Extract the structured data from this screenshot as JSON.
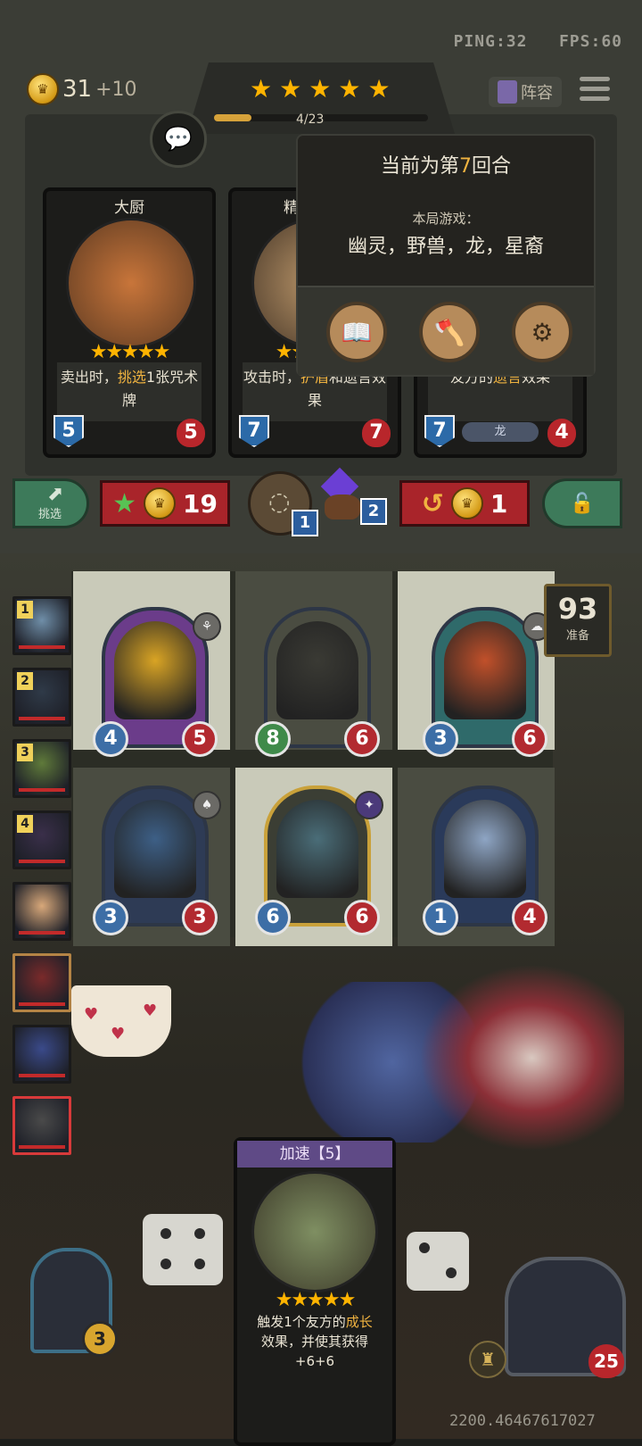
{
  "status": {
    "ping_label": "PING:32",
    "fps_label": "FPS:60"
  },
  "gold": {
    "amount": "31",
    "income": "+10"
  },
  "tavern": {
    "stars": 5,
    "xp_text": "4/23",
    "xp_fraction": 0.174
  },
  "lineup_label": "阵容",
  "shop_cards": [
    {
      "name": "大厨",
      "stars": 5,
      "desc_pre": "卖出时，",
      "desc_hl": "挑选",
      "desc_post": "1张咒术牌",
      "attack": "5",
      "health": "5"
    },
    {
      "name": "精",
      "stars": 5,
      "desc_pre": "攻击时，",
      "desc_hl": "护盾",
      "desc_post": "和遗言效果",
      "attack": "7",
      "health": "7"
    },
    {
      "name": "",
      "stars": 5,
      "desc_pre": "友方的",
      "desc_hl": "遗言",
      "desc_post": "效果",
      "attack": "7",
      "health": "4",
      "tribe": "龙"
    }
  ],
  "popover": {
    "round_pre": "当前为第",
    "round_num": "7",
    "round_post": "回合",
    "game_label": "本局游戏：",
    "tribes": "幽灵，野兽，龙，星裔",
    "buttons": [
      "book-icon",
      "axe-icon",
      "gear-icon"
    ]
  },
  "actions": {
    "pick_label": "挑选",
    "upgrade_cost": "19",
    "refresh_cost": "1",
    "item1_count": "1",
    "item2_count": "2"
  },
  "ready": {
    "count": "93",
    "label": "准备"
  },
  "board": [
    {
      "attack": "4",
      "health": "5",
      "atk_color": "blue",
      "face": "#d9a424",
      "bg": "#6b3c8a",
      "tribe_icon": "beast-icon",
      "gold": false
    },
    {
      "attack": "8",
      "health": "6",
      "atk_color": "green",
      "face": "#3a3a34",
      "bg": "#4a4c41",
      "tribe_icon": "",
      "gold": false
    },
    {
      "attack": "3",
      "health": "6",
      "atk_color": "blue",
      "face": "#c1502a",
      "bg": "#2f6a6a",
      "tribe_icon": "ghost-icon",
      "gold": false
    },
    {
      "attack": "3",
      "health": "3",
      "atk_color": "blue",
      "face": "#3d5f86",
      "bg": "#2e3b55",
      "tribe_icon": "dragon-icon",
      "gold": false
    },
    {
      "attack": "6",
      "health": "6",
      "atk_color": "blue",
      "face": "#4a6d78",
      "bg": "#3b3e34",
      "tribe_icon": "star-icon",
      "gold": true
    },
    {
      "attack": "1",
      "health": "4",
      "atk_color": "blue",
      "face": "#8ea5c4",
      "bg": "#2a3a5a",
      "tribe_icon": "",
      "gold": false
    }
  ],
  "players": [
    {
      "rank": "1",
      "color": "#6f8ea8"
    },
    {
      "rank": "2",
      "color": "#2f3a48"
    },
    {
      "rank": "3",
      "color": "#5f7a3a"
    },
    {
      "rank": "4",
      "color": "#3a2f4a"
    },
    {
      "rank": "",
      "color": "#d8a87a"
    },
    {
      "rank": "",
      "color": "#7a2a2a"
    },
    {
      "rank": "",
      "color": "#3a4a8a"
    },
    {
      "rank": "",
      "color": "#4a4a4a"
    }
  ],
  "spell_card": {
    "title": "加速【5】",
    "stars": 5,
    "desc_pre": "触发1个友方的",
    "desc_hl": "成长",
    "desc_post": "效果，并使其获得",
    "desc_tail": "+6+6"
  },
  "hero": {
    "level": "3",
    "health": "25"
  },
  "coords": "2200.46467617027"
}
